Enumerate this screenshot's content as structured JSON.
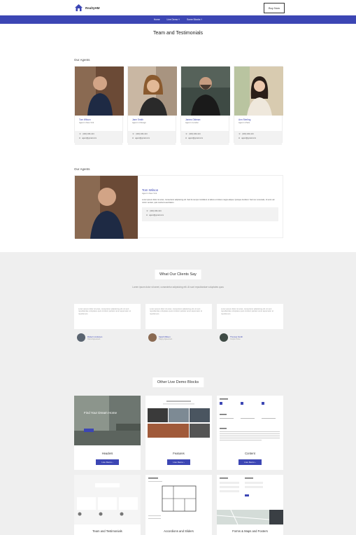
{
  "header": {
    "brand": "RealtyHM",
    "buy_label": "Buy Now"
  },
  "nav": {
    "items": [
      "Home",
      "Live Demo ˅",
      "Some Blocks ˅"
    ]
  },
  "page": {
    "title": "Team and Testimonials"
  },
  "agents_section": {
    "label": "Our Agents",
    "agents": [
      {
        "name": "Tom Wilson",
        "role": "Agent in New York",
        "phone": "(324) 324-124",
        "email": "agent@gmail.com"
      },
      {
        "name": "Jane Smith",
        "role": "Agent in Chicago",
        "phone": "(324) 324-124",
        "email": "agent@gmail.com"
      },
      {
        "name": "James Oldman",
        "role": "Agent in London",
        "phone": "(324) 324-124",
        "email": "agent@gmail.com"
      },
      {
        "name": "Ann Sterling",
        "role": "Agent in Paris",
        "phone": "(324) 324-124",
        "email": "agent@gmail.com"
      }
    ]
  },
  "featured_section": {
    "label": "Our Agents",
    "name": "Tom Wilson",
    "role": "Agent in New York",
    "description": "Lorem ipsum dolor sit amet, consectetur adipisicing elit. Sed do tempor incididunt ut labore et dolore magna aliqua. Quisque tincidunt. Sed nec venenatis, Ut enim ad minim veniam, quis nostrud exercitation.",
    "phone": "(324) 324-124",
    "email": "agent@gmail.com"
  },
  "clients_section": {
    "title": "What Our Clients Say",
    "subtitle": "Lorem ipsum dolor sit amet, consectetur adipisicing elit. At sunt repudiandae voluptates quos",
    "testimonials": [
      {
        "text": "Lorem ipsum dolor sit amet, consectetur adipisicing elit. At sunt repudiandae voluptates quos incidunt pariatur amet aspernatur et repellat eos.",
        "name": "Robert Lindsmen",
        "role": "Client Agreement"
      },
      {
        "text": "Lorem ipsum dolor sit amet, consectetur adipisicing elit. At sunt repudiandae voluptates quos incidunt pariatur amet aspernatur et repellat eos.",
        "name": "Sarah Wilson",
        "role": "Happy Agreement"
      },
      {
        "text": "Lorem ipsum dolor sit amet, consectetur adipisicing elit. At sunt repudiandae voluptates quos incidunt pariatur amet aspernatur et repellat eos.",
        "name": "Thomas Smith",
        "role": "Couple Home"
      }
    ]
  },
  "demo_section": {
    "title": "Other Live Demo Blocks",
    "hero_text": "Find Your Dream Home",
    "cards": [
      {
        "label": "Headers",
        "button": "Live Demo ›"
      },
      {
        "label": "Features",
        "button": "Live Demo ›"
      },
      {
        "label": "Content",
        "button": "Live Demo ›"
      },
      {
        "label": "Team and Testimonials",
        "button": ""
      },
      {
        "label": "Accordions and Sliders",
        "button": ""
      },
      {
        "label": "Forms & Maps and Footers",
        "button": ""
      }
    ]
  },
  "colors": {
    "accent": "#3c46b4",
    "section_gray": "#efefef"
  }
}
